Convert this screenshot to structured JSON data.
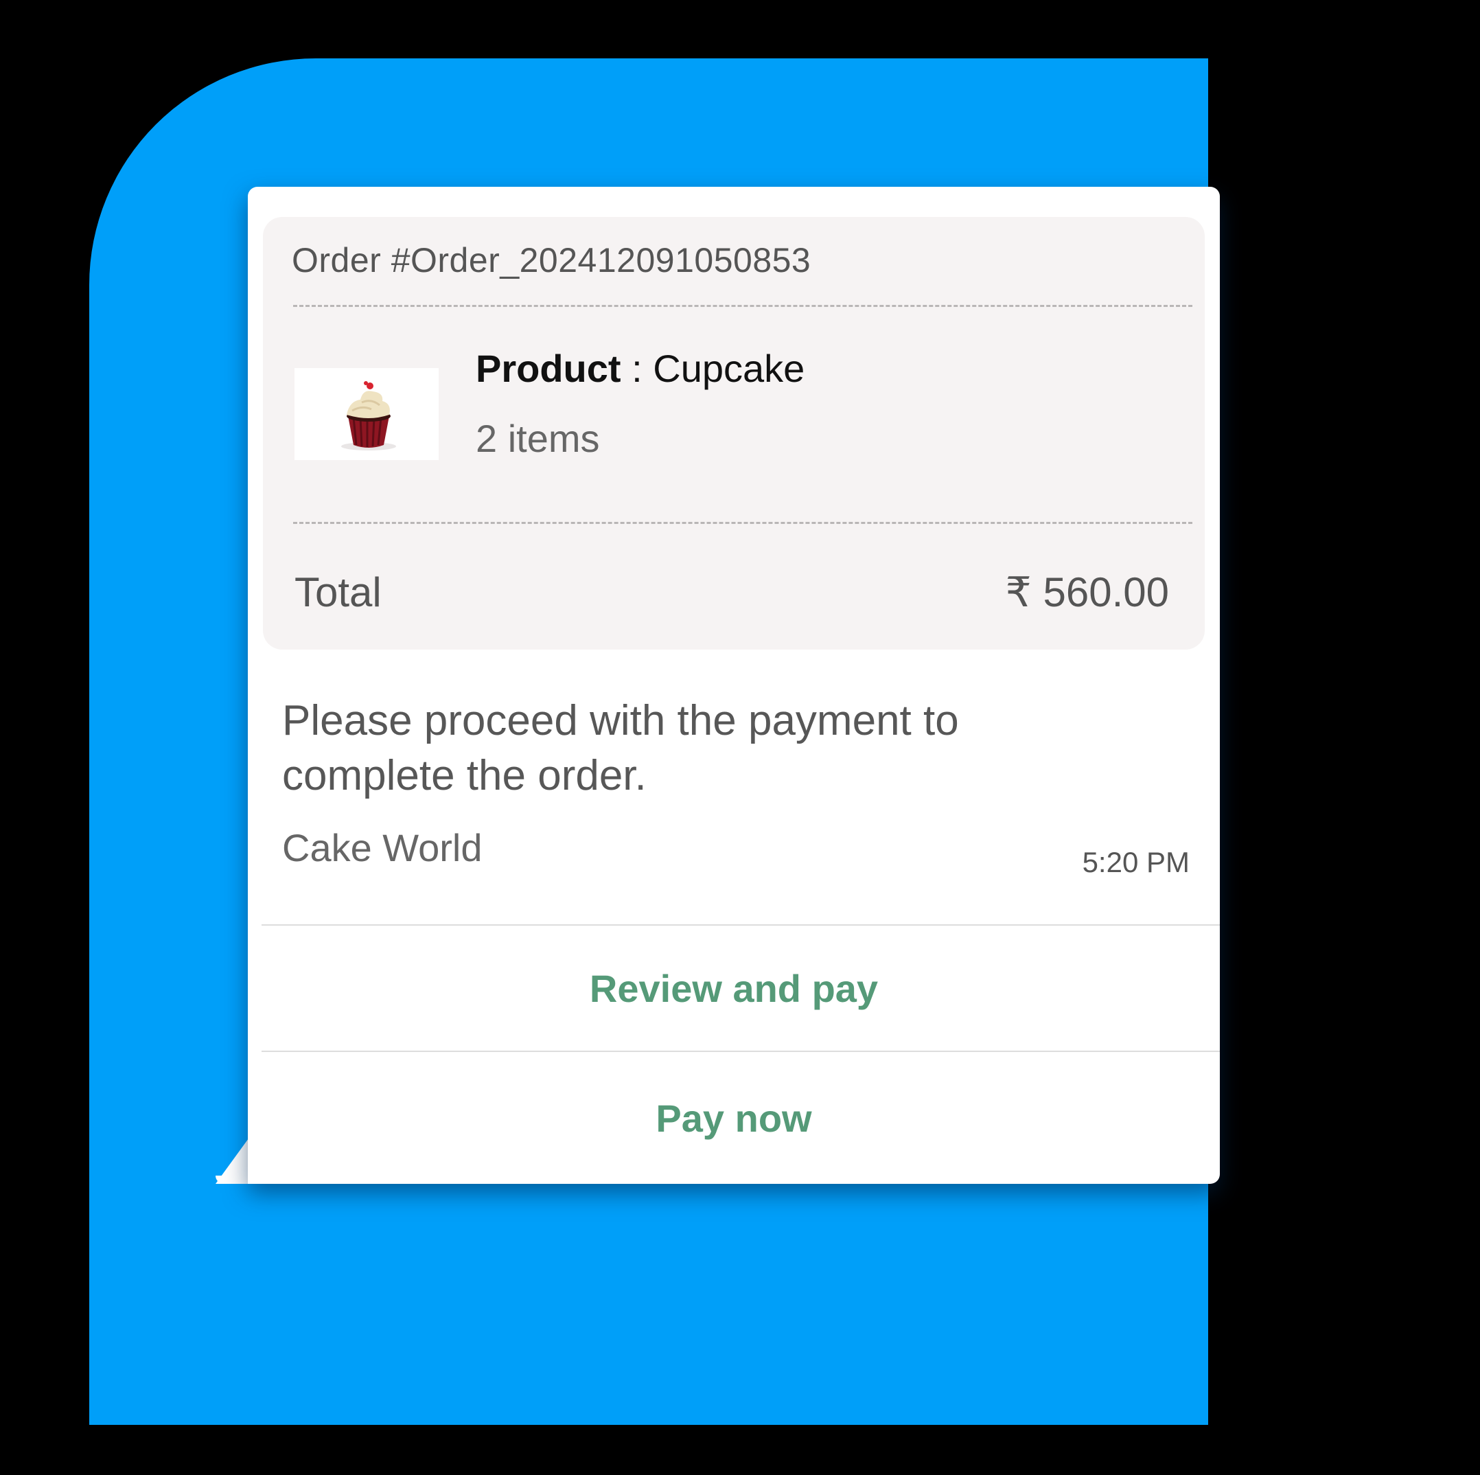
{
  "order": {
    "title": "Order #Order_202412091050853",
    "product_label": "Product",
    "product_separator": " : ",
    "product_name": "Cupcake",
    "product_image": "cupcake-image",
    "items_count": "2 items",
    "total_label": "Total",
    "total_value": "₹ 560.00"
  },
  "message": {
    "body": "Please proceed with the payment to complete the order.",
    "seller": "Cake World",
    "time": "5:20 PM"
  },
  "actions": {
    "review_label": "Review and pay",
    "pay_label": "Pay now"
  },
  "colors": {
    "background": "#000000",
    "glow": "#009ff9",
    "card": "#f6f3f3",
    "action_text": "#559a78"
  }
}
